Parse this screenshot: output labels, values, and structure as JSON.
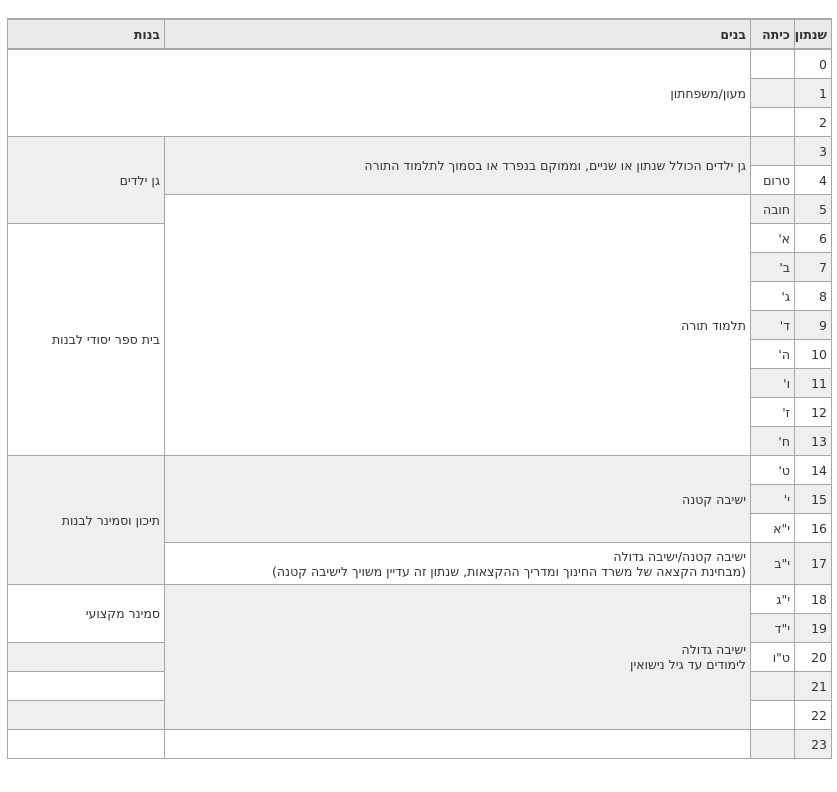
{
  "headers": {
    "age": "שנתון",
    "grade": "כיתה",
    "boys": "בנים",
    "girls": "בנות"
  },
  "rows": [
    {
      "age": "0",
      "grade": ""
    },
    {
      "age": "1",
      "grade": ""
    },
    {
      "age": "2",
      "grade": ""
    },
    {
      "age": "3",
      "grade": ""
    },
    {
      "age": "4",
      "grade": "טרום"
    },
    {
      "age": "5",
      "grade": "חובה"
    },
    {
      "age": "6",
      "grade": "א'"
    },
    {
      "age": "7",
      "grade": "ב'"
    },
    {
      "age": "8",
      "grade": "ג'"
    },
    {
      "age": "9",
      "grade": "ד'"
    },
    {
      "age": "10",
      "grade": "ה'"
    },
    {
      "age": "11",
      "grade": "ו'"
    },
    {
      "age": "12",
      "grade": "ז'"
    },
    {
      "age": "13",
      "grade": "ח'"
    },
    {
      "age": "14",
      "grade": "ט'"
    },
    {
      "age": "15",
      "grade": "י'"
    },
    {
      "age": "16",
      "grade": "י\"א"
    },
    {
      "age": "17",
      "grade": "י\"ב"
    },
    {
      "age": "18",
      "grade": "י\"ג"
    },
    {
      "age": "19",
      "grade": "י\"ד"
    },
    {
      "age": "20",
      "grade": "ט\"ו"
    },
    {
      "age": "21",
      "grade": ""
    },
    {
      "age": "22",
      "grade": ""
    },
    {
      "age": "23",
      "grade": ""
    }
  ],
  "boys": {
    "daycare": "מעון/משפחתון",
    "kindergarten": "גן ילדים הכולל שנתון או שניים, וממוקם בנפרד או בסמוך לתלמוד התורה",
    "talmud_torah": "תלמוד תורה",
    "yeshiva_ketana": "ישיבה קטנה",
    "transition_line1": "ישיבה קטנה/ישיבה גדולה",
    "transition_line2": "(מבחינת הקצאה של משרד החינוך ומדריך ההקצאות, שנתון זה עדיין משויך לישיבה קטנה)",
    "yeshiva_gedola_line1": "ישיבה גדולה",
    "yeshiva_gedola_line2": "לימודים עד גיל נישואין"
  },
  "girls": {
    "kindergarten": "גן ילדים",
    "primary": "בית ספר יסודי לבנות",
    "high_school": "תיכון וסמינר לבנות",
    "professional_seminary": "סמינר מקצועי"
  }
}
